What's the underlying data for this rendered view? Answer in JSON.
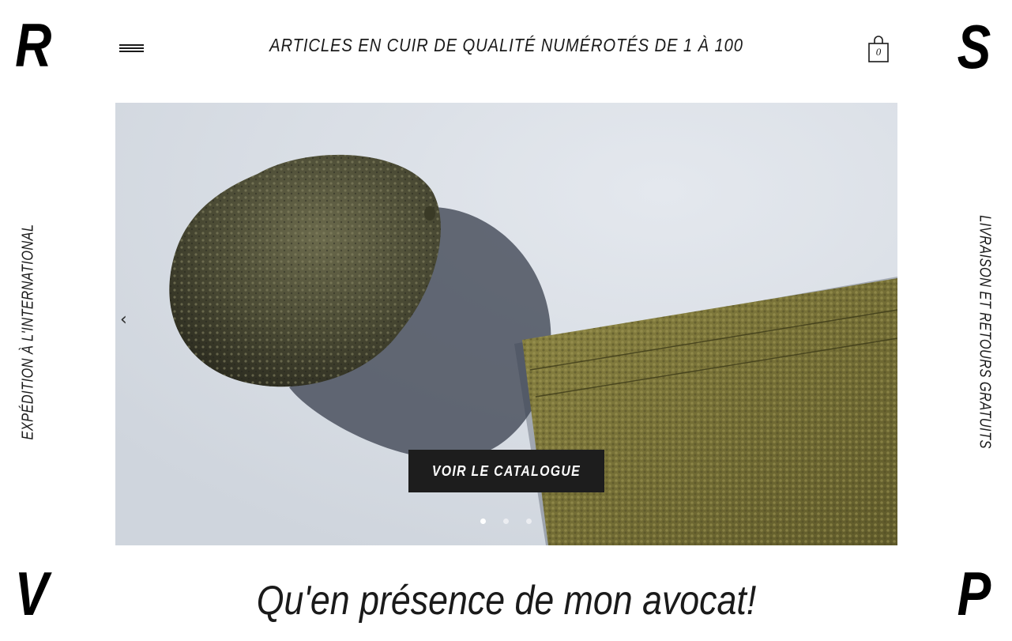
{
  "corners": {
    "top_left": "R",
    "top_right": "S",
    "bottom_left": "V",
    "bottom_right": "P"
  },
  "side": {
    "left_text": "EXPÉDITION À L'INTERNATIONAL",
    "right_text": "LIVRAISON ET RETOURS GRATUITS"
  },
  "header": {
    "menu_icon": "hamburger-icon",
    "title": "ARTICLES EN CUIR DE QUALITÉ NUMÉROTÉS DE 1 À 100",
    "cart_icon": "shopping-bag-icon",
    "cart_count": "0"
  },
  "hero": {
    "prev_arrow": "‹",
    "cta_label": "VOIR LE CATALOGUE",
    "slides_total": 3,
    "active_slide": 1,
    "colors": {
      "background": "#d8dde4",
      "avocado": "#4a4a34",
      "leather": "#7a7438",
      "cta": "#1d1d1d"
    }
  },
  "tagline": "Qu'en présence de mon avocat!"
}
